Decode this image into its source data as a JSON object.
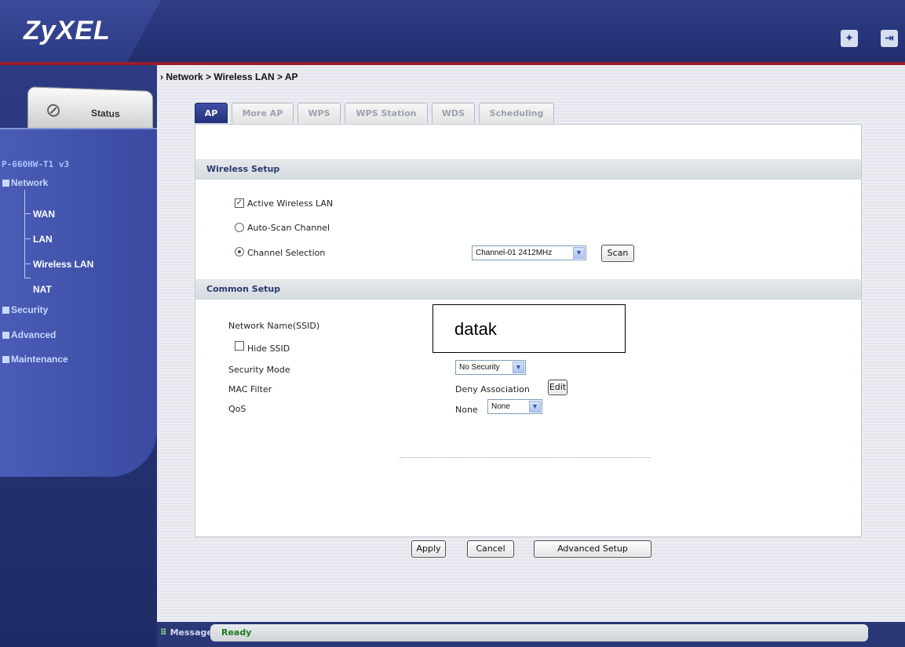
{
  "header": {
    "logo": "ZyXEL",
    "icons": [
      "wizard-icon",
      "logout-icon"
    ]
  },
  "sidebar": {
    "status_label": "Status",
    "model": "P-660HW-T1 v3",
    "network": "Network",
    "network_items": [
      "WAN",
      "LAN",
      "Wireless LAN",
      "NAT"
    ],
    "security": "Security",
    "advanced": "Advanced",
    "maintenance": "Maintenance"
  },
  "breadcrumb": "Network > Wireless LAN > AP",
  "tabs": [
    "AP",
    "More AP",
    "WPS",
    "WPS Station",
    "WDS",
    "Scheduling"
  ],
  "active_tab": "AP",
  "wireless_setup": {
    "heading": "Wireless Setup",
    "active_wlan_label": "Active Wireless LAN",
    "active_wlan_checked": true,
    "auto_scan_label": "Auto-Scan Channel",
    "channel_selection_label": "Channel Selection",
    "selected_mode": "Channel Selection",
    "channel_value": "Channel-01 2412MHz",
    "scan_button": "Scan"
  },
  "common_setup": {
    "heading": "Common Setup",
    "ssid_label": "Network Name(SSID)",
    "ssid_value": "datak",
    "hide_ssid_label": "Hide SSID",
    "hide_ssid_checked": false,
    "security_mode_label": "Security Mode",
    "security_mode_value": "No Security",
    "mac_filter_label": "MAC Filter",
    "mac_filter_value": "Deny Association",
    "mac_filter_edit": "Edit",
    "qos_label": "QoS",
    "qos_text": "None",
    "qos_value": "None"
  },
  "buttons": {
    "apply": "Apply",
    "cancel": "Cancel",
    "advanced_setup": "Advanced Setup"
  },
  "statusbar": {
    "label": "Message",
    "message": "Ready"
  },
  "colors": {
    "header": "#263578",
    "accent_red": "#9a1d2c",
    "nav": "#4a5cb6",
    "ready_green": "#1e7a1e"
  }
}
